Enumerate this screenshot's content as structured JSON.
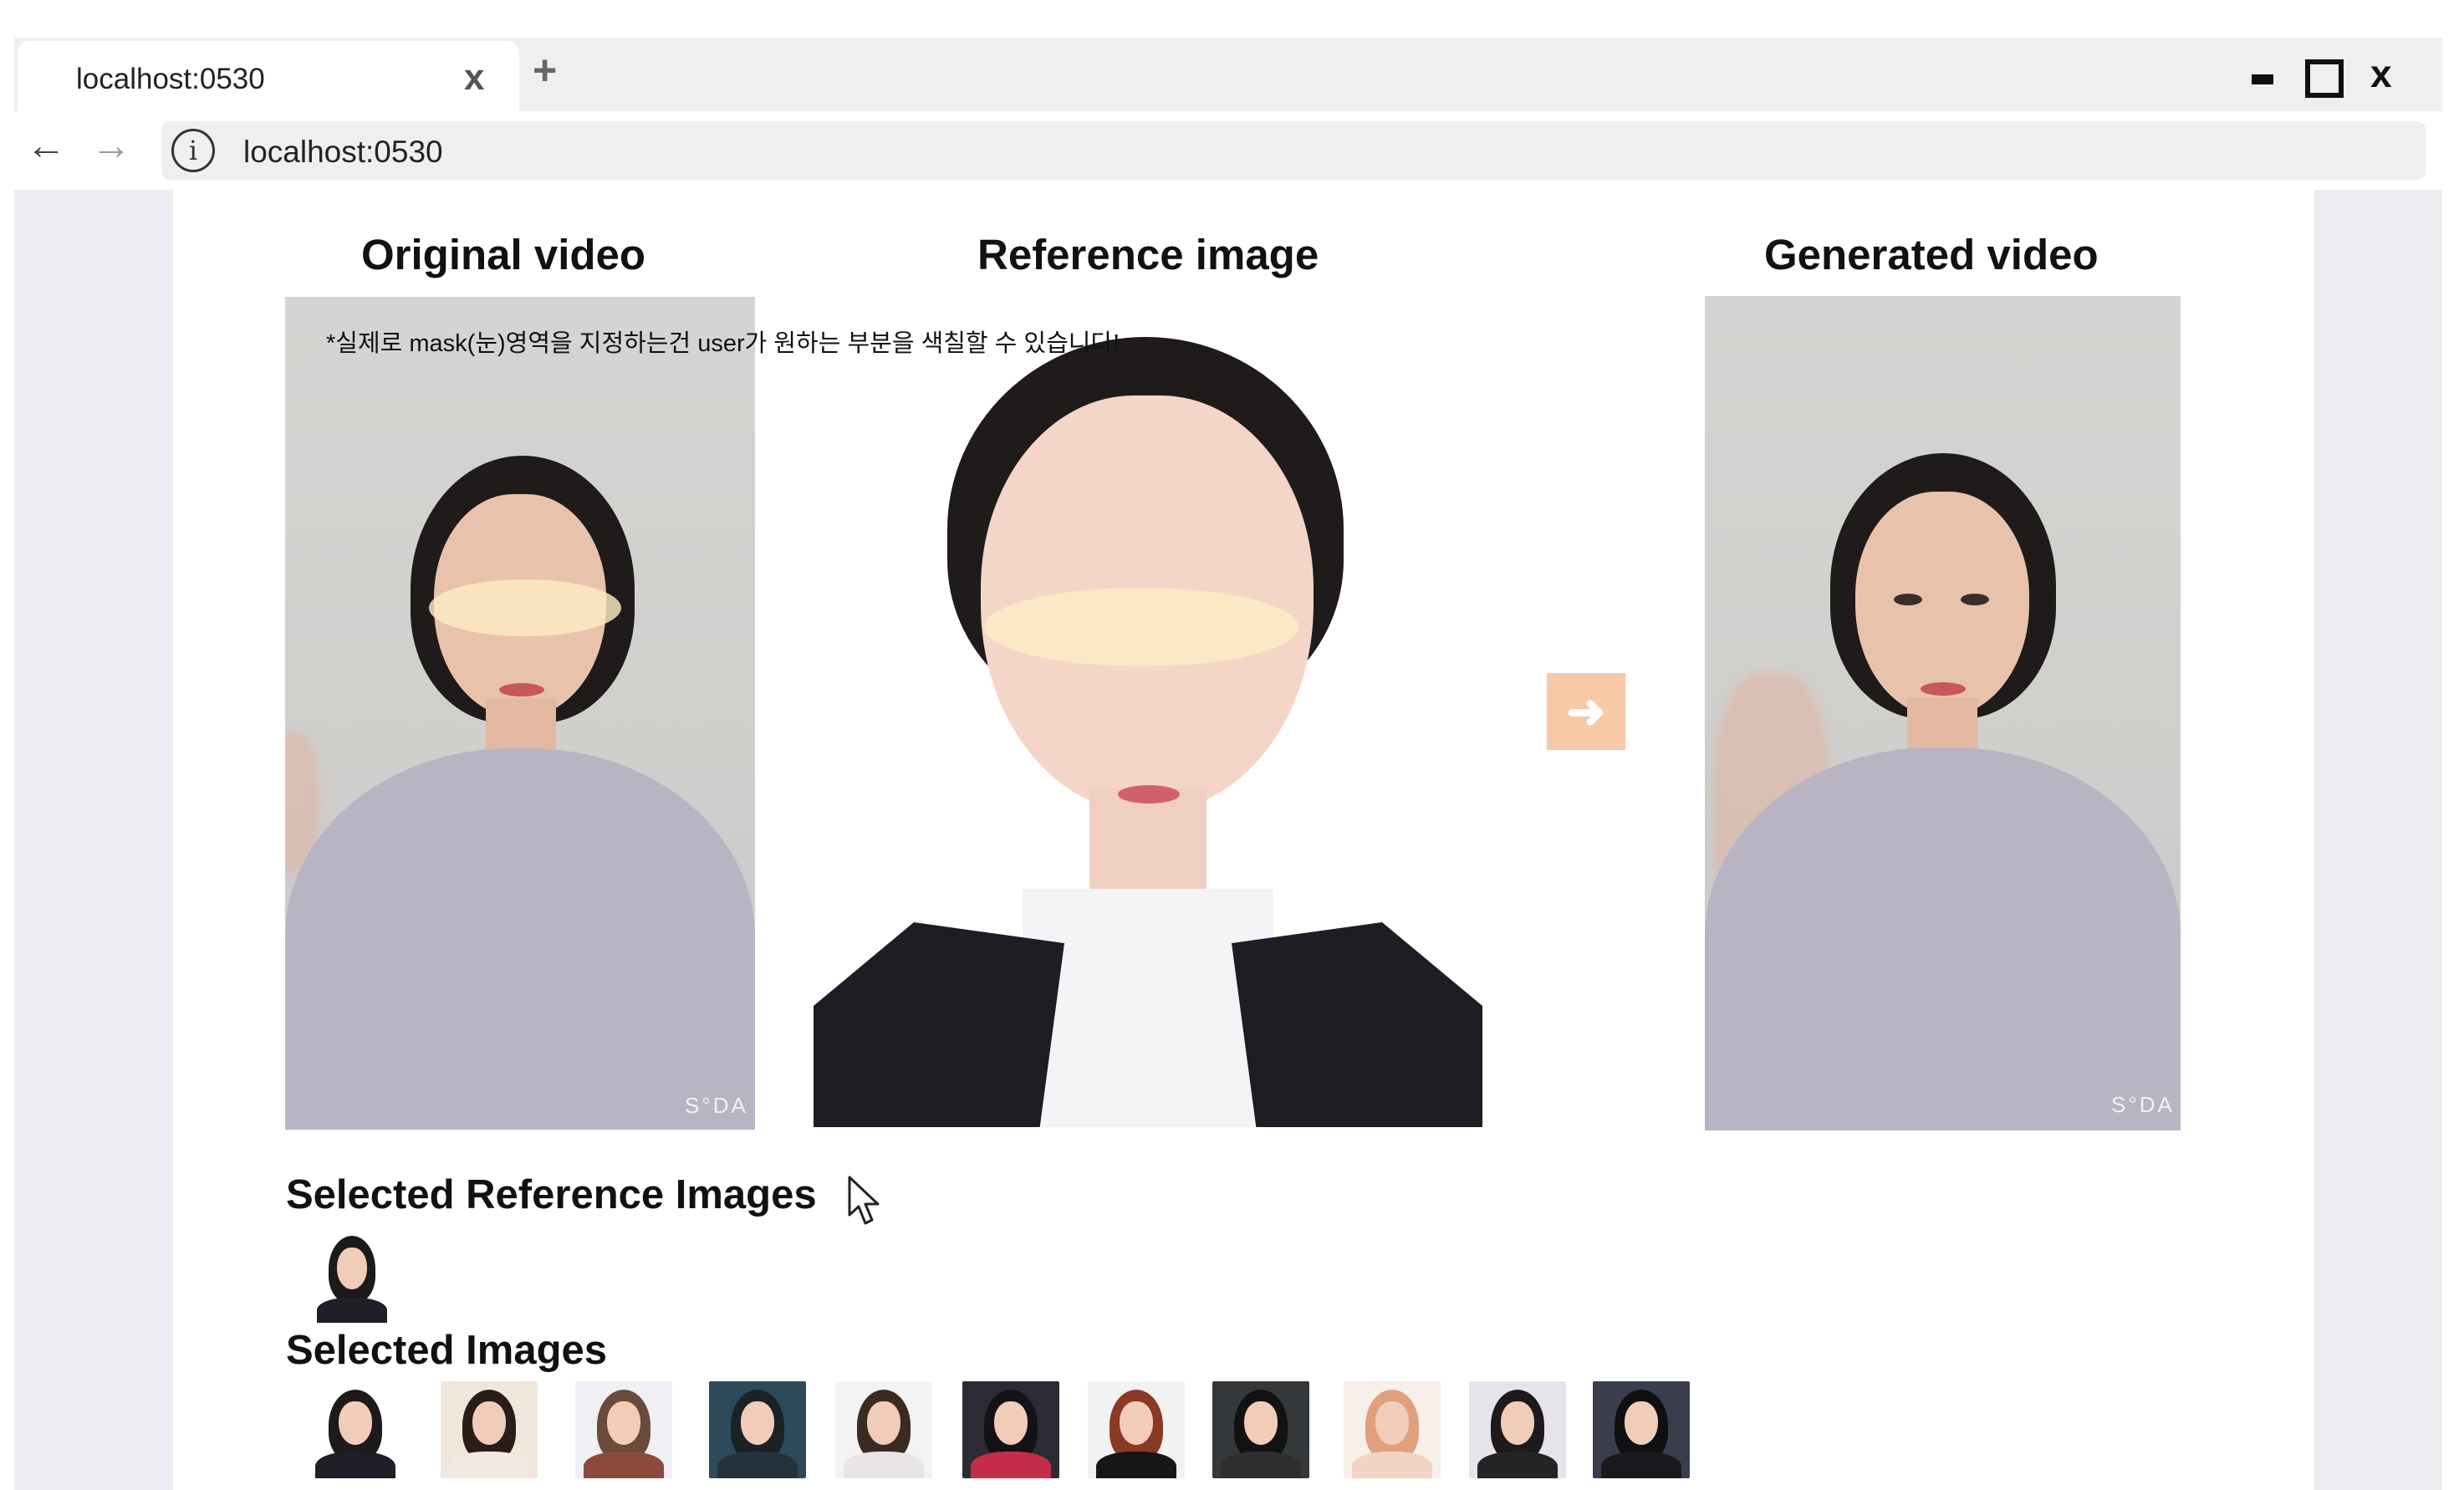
{
  "browser": {
    "tab_title": "localhost:0530",
    "tab_close": "x",
    "new_tab": "+",
    "window_close": "x",
    "back": "←",
    "forward": "→",
    "info": "i",
    "address": "localhost:0530"
  },
  "columns": {
    "original_title": "Original video",
    "reference_title": "Reference image",
    "generated_title": "Generated video"
  },
  "note": "*실제로 mask(눈)영역을 지정하는건 user가 원하는 부분을 색칠할 수 있습니다!",
  "watermark": "S°DA",
  "arrow_symbol": "➜",
  "sections": {
    "selected_reference_title": "Selected Reference Images",
    "selected_images_title": "Selected Images"
  },
  "colors": {
    "mask": "#fcecc4",
    "arrow_button": "#f7c9a6"
  },
  "selected_images": [
    {
      "name": "image-1",
      "bg": "#ffffff",
      "hair": "#1d1a1a",
      "body": "#1f1f28"
    },
    {
      "name": "image-2",
      "bg": "#efe7dc",
      "hair": "#2a1d18",
      "body": "#f3e9e0"
    },
    {
      "name": "image-3",
      "bg": "#eef0f4",
      "hair": "#6a4a3a",
      "body": "#8b4a3c"
    },
    {
      "name": "image-4",
      "bg": "#2c4a5c",
      "hair": "#1b2226",
      "body": "#24323c"
    },
    {
      "name": "image-5",
      "bg": "#f3f3f3",
      "hair": "#3b2a22",
      "body": "#e9e4e6"
    },
    {
      "name": "image-6",
      "bg": "#2e2a35",
      "hair": "#141216",
      "body": "#c42d4a"
    },
    {
      "name": "image-7",
      "bg": "#f2f2f2",
      "hair": "#8a3a24",
      "body": "#161616"
    },
    {
      "name": "image-8",
      "bg": "#34383a",
      "hair": "#121212",
      "body": "#2e2e2e"
    },
    {
      "name": "image-9",
      "bg": "#f6efea",
      "hair": "#e0a07c",
      "body": "#f1d4c6"
    },
    {
      "name": "image-10",
      "bg": "#e6e4ea",
      "hair": "#1e1a1c",
      "body": "#242424"
    },
    {
      "name": "image-11",
      "bg": "#3a3e4c",
      "hair": "#101012",
      "body": "#1a1a1e"
    }
  ]
}
